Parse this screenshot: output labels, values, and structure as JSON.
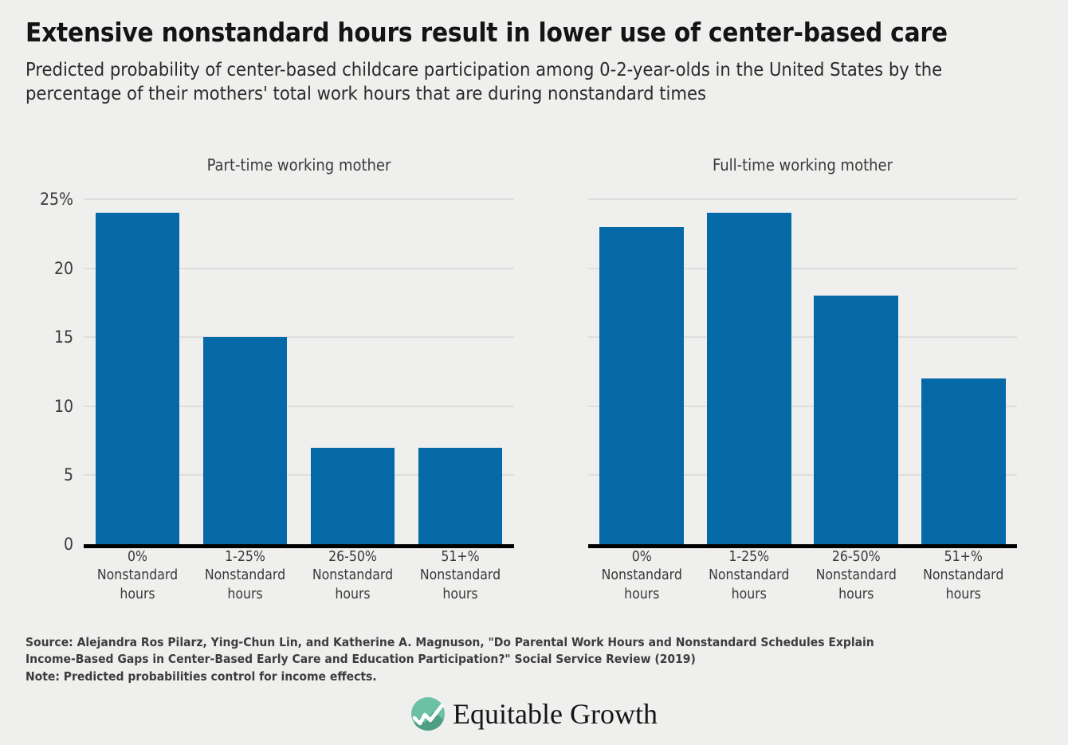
{
  "title": "Extensive nonstandard hours result in lower use of center-based care",
  "subtitle": "Predicted probability of center-based childcare participation among 0-2-year-olds in the United States by the percentage of their mothers' total work hours that are during nonstandard times",
  "footer": {
    "source_line_1": "Source: Alejandra Ros Pilarz, Ying-Chun Lin, and Katherine A. Magnuson, \"Do Parental Work Hours and Nonstandard Schedules Explain",
    "source_line_2": "Income-Based Gaps in Center-Based Early Care and Education Participation?\" Social Service Review (2019)",
    "note_line": "Note: Predicted probabilities control for income effects."
  },
  "logo": {
    "text": "Equitable Growth",
    "icon": "equitable-growth-mark",
    "circle_color": "#6cc0a4",
    "hill_color": "#4e9e84"
  },
  "chart_data": {
    "type": "bar",
    "title": "Extensive nonstandard hours result in lower use of center-based care",
    "subtitle": "Predicted probability of center-based childcare participation among 0-2-year-olds in the United States by the percentage of their mothers' total work hours that are during nonstandard times",
    "xlabel": "",
    "ylabel": "",
    "ylim": [
      0,
      25
    ],
    "grid": true,
    "legend": "none",
    "bar_color": "#0669a7",
    "ytick_values": [
      0,
      5,
      10,
      15,
      20,
      25
    ],
    "ytick_labels": [
      "0",
      "5",
      "10",
      "15",
      "20",
      "25%"
    ],
    "categories": [
      "0%\nNonstandard\nhours",
      "1-25%\nNonstandard\nhours",
      "26-50%\nNonstandard\nhours",
      "51+%\nNonstandard\nhours"
    ],
    "category_lines": [
      [
        "0%",
        "Nonstandard",
        "hours"
      ],
      [
        "1-25%",
        "Nonstandard",
        "hours"
      ],
      [
        "26-50%",
        "Nonstandard",
        "hours"
      ],
      [
        "51+%",
        "Nonstandard",
        "hours"
      ]
    ],
    "panels": [
      {
        "title": "Part-time working mother",
        "values": [
          24,
          15,
          7,
          7
        ]
      },
      {
        "title": "Full-time working mother",
        "values": [
          23,
          24,
          18,
          12
        ]
      }
    ]
  }
}
